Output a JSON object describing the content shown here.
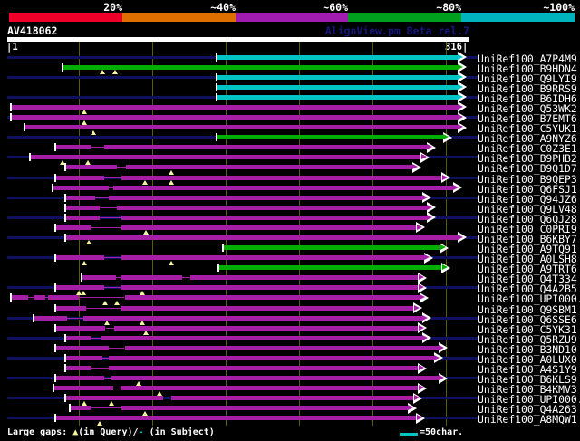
{
  "header": {
    "query_id": "AV418062",
    "app_title": "AlignView.pm Beta rel.7"
  },
  "footer": {
    "prefix": "Large gaps: ",
    "query_marker": "▲",
    "query_text": "(in Query)/",
    "subject_marker": "-",
    "subject_text": " (in Subject)",
    "scalebar_label": "=50char."
  },
  "colors": {
    "background": "#000000",
    "bar_magenta": "#a51ea5",
    "bar_green": "#00ae00",
    "bar_cyan": "#00c4c4",
    "navy_line": "#101060",
    "gridline": "#5c5c00",
    "gap_marker": "#f5f5a0",
    "query_bar": "#ffffff",
    "app_title_color": "#16167e",
    "scalebar_cyan": "#00c4c4",
    "label_text": "#ffffff"
  },
  "chart_data": {
    "type": "bar",
    "orientation": "horizontal",
    "title": "AV418062",
    "x_axis": {
      "min": 1,
      "max": 316,
      "start_label": "1",
      "end_label": "316",
      "gridlines": [
        50,
        100,
        150,
        200,
        250,
        300
      ],
      "gridline_interval_chars": 50
    },
    "identity_legend": [
      {
        "label": "20%",
        "color": "#ee0028"
      },
      {
        "label": "~40%",
        "color": "#dd6e00"
      },
      {
        "label": "~60%",
        "color": "#a01cb0"
      },
      {
        "label": "~80%",
        "color": "#00a01e"
      },
      {
        "label": "~100%",
        "color": "#00b4be"
      }
    ],
    "legend_note": "color encodes % identity",
    "hits": [
      {
        "label": "UniRef100_A7P4M9",
        "color": "cyan",
        "start": 144,
        "end": 314,
        "navy": true,
        "gaps": [],
        "thin": []
      },
      {
        "label": "UniRef100_B9HDN4",
        "color": "green",
        "start": 39,
        "end": 314,
        "navy": false,
        "gaps": [
          66,
          75
        ],
        "thin": []
      },
      {
        "label": "UniRef100_Q9LYI9",
        "color": "cyan",
        "start": 144,
        "end": 314,
        "navy": true,
        "gaps": [],
        "thin": []
      },
      {
        "label": "UniRef100_B9RRS9",
        "color": "cyan",
        "start": 144,
        "end": 314,
        "navy": false,
        "gaps": [],
        "thin": []
      },
      {
        "label": "UniRef100_B6IDH6",
        "color": "cyan",
        "start": 144,
        "end": 314,
        "navy": true,
        "gaps": [],
        "thin": []
      },
      {
        "label": "UniRef100_Q53WK2",
        "color": "magenta",
        "start": 4,
        "end": 314,
        "navy": false,
        "gaps": [
          54
        ],
        "thin": []
      },
      {
        "label": "UniRef100_B7EMT6",
        "color": "magenta",
        "start": 4,
        "end": 314,
        "navy": true,
        "gaps": [
          54
        ],
        "thin": []
      },
      {
        "label": "UniRef100_C5YUK1",
        "color": "magenta",
        "start": 13,
        "end": 314,
        "navy": false,
        "gaps": [
          60
        ],
        "thin": []
      },
      {
        "label": "UniRef100_A9NYZ6",
        "color": "green",
        "start": 144,
        "end": 304,
        "navy": true,
        "gaps": [],
        "thin": []
      },
      {
        "label": "UniRef100_C0Z3E1",
        "color": "magenta",
        "start": 34,
        "end": 293,
        "navy": false,
        "gaps": [],
        "thin": [
          [
            58,
            67
          ]
        ]
      },
      {
        "label": "UniRef100_B9PHB2",
        "color": "magenta",
        "start": 17,
        "end": 289,
        "navy": true,
        "gaps": [
          39,
          56
        ],
        "thin": []
      },
      {
        "label": "UniRef100_B9Q1D7",
        "color": "magenta",
        "start": 41,
        "end": 283,
        "navy": false,
        "gaps": [
          113
        ],
        "thin": [
          [
            76,
            82
          ]
        ]
      },
      {
        "label": "UniRef100_B9QEP3",
        "color": "magenta",
        "start": 34,
        "end": 303,
        "navy": true,
        "gaps": [
          95,
          113
        ],
        "thin": [
          [
            67,
            79
          ]
        ]
      },
      {
        "label": "UniRef100_Q6FSJ1",
        "color": "magenta",
        "start": 32,
        "end": 311,
        "navy": false,
        "gaps": [],
        "thin": [
          [
            70,
            73
          ]
        ]
      },
      {
        "label": "UniRef100_Q94JZ6",
        "color": "magenta",
        "start": 41,
        "end": 290,
        "navy": true,
        "gaps": [],
        "thin": [
          [
            61,
            70
          ]
        ]
      },
      {
        "label": "UniRef100_Q9LV48",
        "color": "magenta",
        "start": 41,
        "end": 293,
        "navy": false,
        "gaps": [],
        "thin": [
          [
            64,
            76
          ]
        ]
      },
      {
        "label": "UniRef100_Q6QJ28",
        "color": "magenta",
        "start": 41,
        "end": 293,
        "navy": true,
        "gaps": [],
        "thin": [
          [
            64,
            79
          ]
        ]
      },
      {
        "label": "UniRef100_C0PRI9",
        "color": "magenta",
        "start": 34,
        "end": 286,
        "navy": false,
        "gaps": [
          96
        ],
        "thin": [
          [
            58,
            79
          ]
        ]
      },
      {
        "label": "UniRef100_B6KBY7",
        "color": "magenta",
        "start": 41,
        "end": 314,
        "navy": true,
        "gaps": [
          57
        ],
        "thin": []
      },
      {
        "label": "UniRef100_A9TQ91",
        "color": "green",
        "start": 148,
        "end": 302,
        "navy": false,
        "gaps": [],
        "thin": []
      },
      {
        "label": "UniRef100_A0LSH8",
        "color": "magenta",
        "start": 34,
        "end": 291,
        "navy": true,
        "gaps": [
          54,
          113
        ],
        "thin": [
          [
            67,
            79
          ]
        ]
      },
      {
        "label": "UniRef100_A9TRT6",
        "color": "green",
        "start": 145,
        "end": 303,
        "navy": false,
        "gaps": [],
        "thin": []
      },
      {
        "label": "UniRef100_Q4T334",
        "color": "magenta",
        "start": 52,
        "end": 287,
        "navy": false,
        "gaps": [],
        "thin": [
          [
            75,
            78
          ],
          [
            120,
            126
          ]
        ]
      },
      {
        "label": "UniRef100_Q4A2B5",
        "color": "magenta",
        "start": 34,
        "end": 287,
        "navy": true,
        "gaps": [
          50,
          53,
          93
        ],
        "thin": [
          [
            67,
            78
          ]
        ]
      },
      {
        "label": "UniRef100_UPI000..",
        "color": "magenta",
        "start": 4,
        "end": 288,
        "navy": false,
        "gaps": [
          68,
          76
        ],
        "thin": [
          [
            15,
            19
          ],
          [
            27,
            29
          ],
          [
            50,
            81
          ]
        ]
      },
      {
        "label": "UniRef100_Q9SBM1",
        "color": "magenta",
        "start": 34,
        "end": 284,
        "navy": false,
        "gaps": [],
        "thin": [
          [
            55,
            79
          ]
        ]
      },
      {
        "label": "UniRef100_Q6SSE6",
        "color": "magenta",
        "start": 19,
        "end": 290,
        "navy": true,
        "gaps": [
          69,
          93
        ],
        "thin": [
          [
            42,
            53
          ]
        ]
      },
      {
        "label": "UniRef100_C5YK31",
        "color": "magenta",
        "start": 34,
        "end": 287,
        "navy": false,
        "gaps": [
          96
        ],
        "thin": [
          [
            68,
            74
          ]
        ]
      },
      {
        "label": "UniRef100_Q5RZU9",
        "color": "magenta",
        "start": 41,
        "end": 290,
        "navy": true,
        "gaps": [],
        "thin": [
          [
            58,
            65
          ]
        ]
      },
      {
        "label": "UniRef100_B3ND10",
        "color": "magenta",
        "start": 34,
        "end": 301,
        "navy": false,
        "gaps": [],
        "thin": [
          [
            70,
            81
          ]
        ]
      },
      {
        "label": "UniRef100_A0LUX0",
        "color": "magenta",
        "start": 41,
        "end": 298,
        "navy": true,
        "gaps": [],
        "thin": [
          [
            66,
            70
          ]
        ]
      },
      {
        "label": "UniRef100_A4S1Y9",
        "color": "magenta",
        "start": 41,
        "end": 287,
        "navy": false,
        "gaps": [],
        "thin": [
          [
            58,
            70
          ]
        ]
      },
      {
        "label": "UniRef100_B6KLS9",
        "color": "magenta",
        "start": 34,
        "end": 301,
        "navy": true,
        "gaps": [
          91
        ],
        "thin": [
          [
            67,
            72
          ]
        ]
      },
      {
        "label": "UniRef100_B4KMV3",
        "color": "magenta",
        "start": 33,
        "end": 287,
        "navy": false,
        "gaps": [
          105
        ],
        "thin": [
          [
            73,
            78
          ]
        ]
      },
      {
        "label": "UniRef100_UPI000..",
        "color": "magenta",
        "start": 41,
        "end": 284,
        "navy": true,
        "gaps": [
          54,
          72
        ],
        "thin": [
          [
            107,
            113
          ]
        ]
      },
      {
        "label": "UniRef100_Q4A263",
        "color": "magenta",
        "start": 44,
        "end": 280,
        "navy": false,
        "gaps": [
          95
        ],
        "thin": [
          [
            58,
            79
          ]
        ]
      },
      {
        "label": "UniRef100_A8MQW1",
        "color": "magenta",
        "start": 34,
        "end": 286,
        "navy": true,
        "gaps": [
          64
        ],
        "thin": []
      }
    ]
  }
}
